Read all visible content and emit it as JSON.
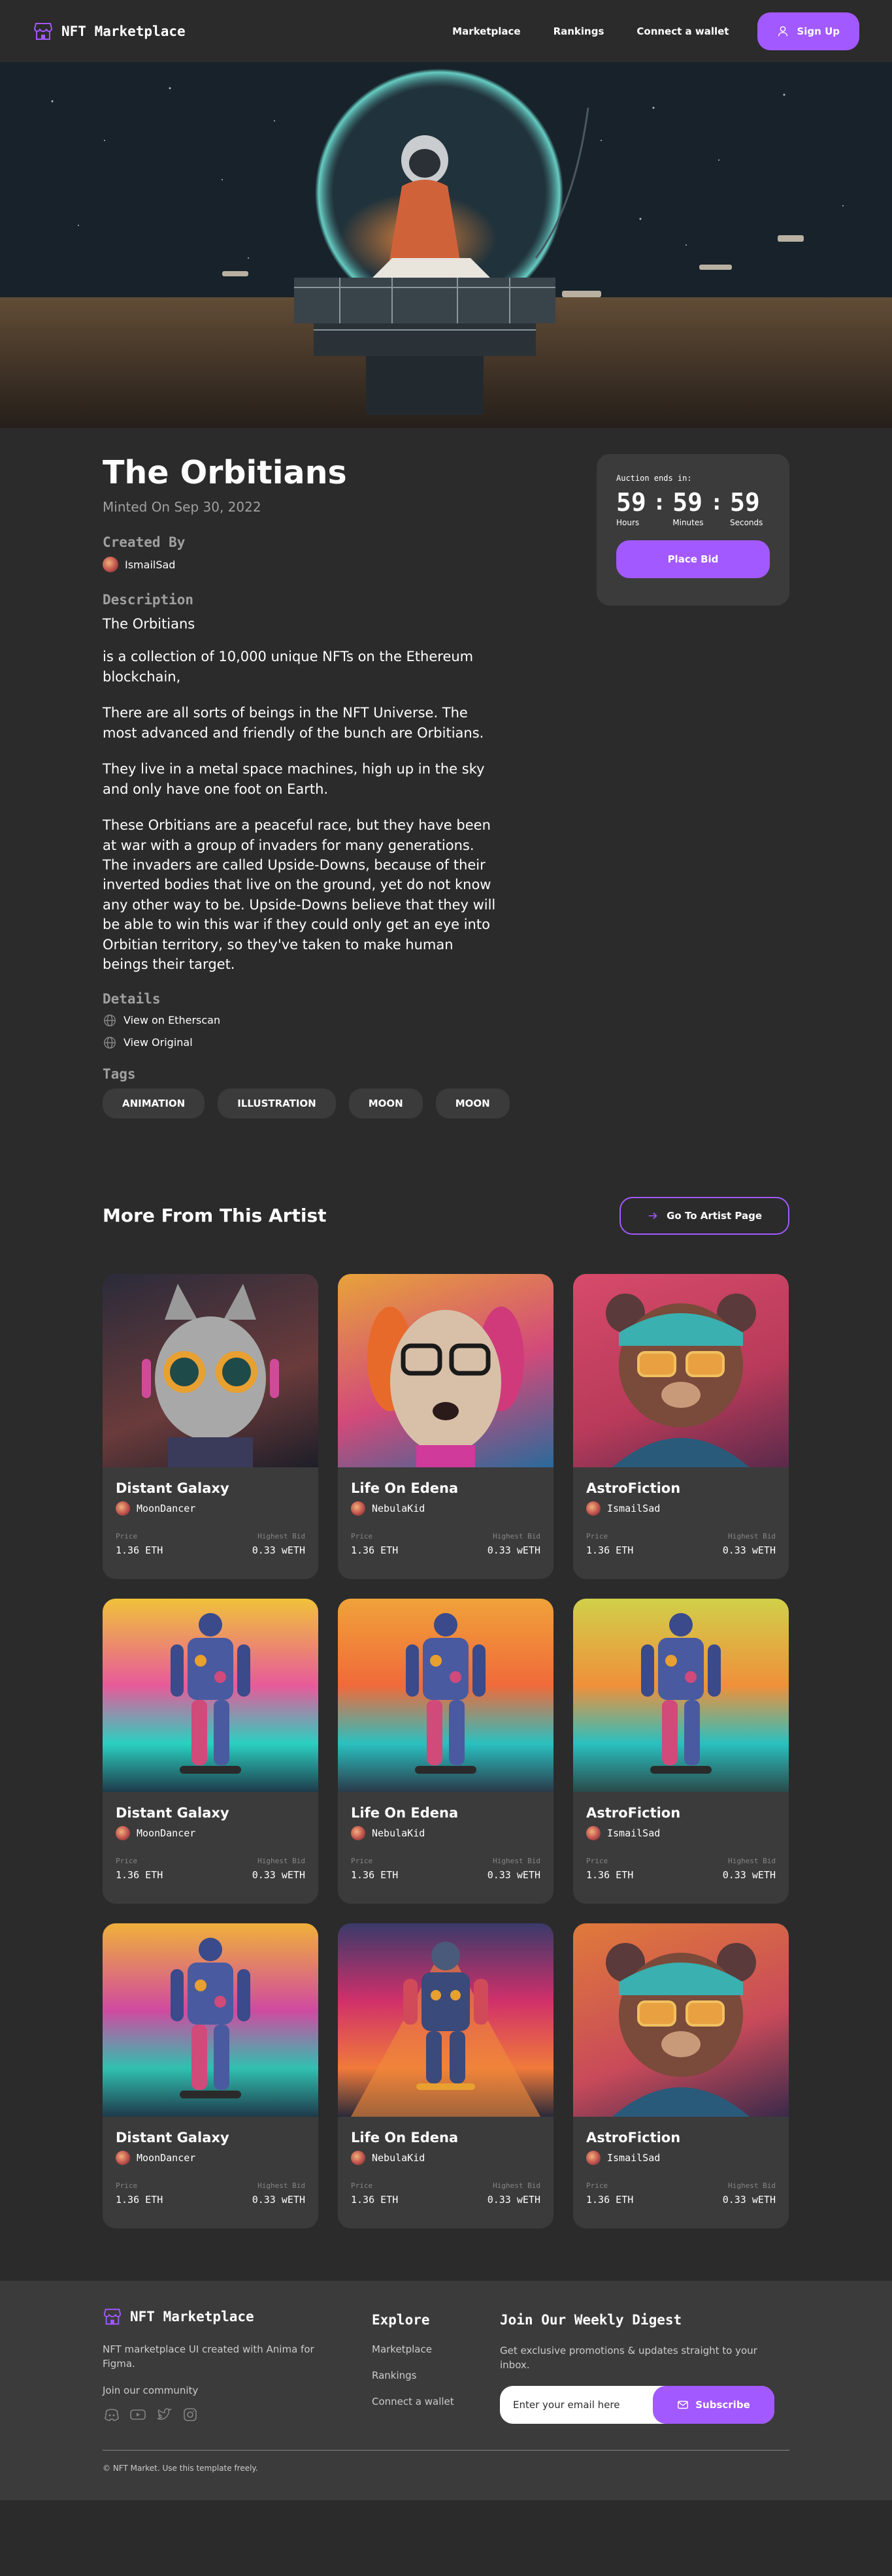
{
  "nav": {
    "brand": "NFT Marketplace",
    "links": [
      "Marketplace",
      "Rankings",
      "Connect a wallet"
    ],
    "signup": "Sign Up"
  },
  "nft": {
    "title": "The Orbitians",
    "minted": "Minted On Sep 30, 2022",
    "created_by_label": "Created By",
    "creator": "IsmailSad",
    "description_label": "Description",
    "description": [
      "The Orbitians",
      "is a collection of 10,000 unique NFTs on the Ethereum blockchain,",
      "There are all sorts of beings in the NFT Universe. The most advanced and friendly of the bunch are Orbitians.",
      "They live in a metal space machines, high up in the sky and only have one foot on Earth.",
      "These Orbitians are a peaceful race, but they have been at war with a group of invaders for many generations. The invaders are called Upside-Downs, because of their inverted bodies that live on the ground, yet do not know any other way to be. Upside-Downs believe that they will be able to win this war if they could only get an eye into Orbitian territory, so they've taken to make human beings their target."
    ],
    "details_label": "Details",
    "details": [
      "View on Etherscan",
      "View Original"
    ],
    "tags_label": "Tags",
    "tags": [
      "ANIMATION",
      "ILLUSTRATION",
      "MOON",
      "MOON"
    ]
  },
  "auction": {
    "label": "Auction ends in:",
    "hours": "59",
    "minutes": "59",
    "seconds": "59",
    "hours_label": "Hours",
    "minutes_label": "Minutes",
    "seconds_label": "Seconds",
    "bid": "Place Bid"
  },
  "more": {
    "title": "More From This Artist",
    "button": "Go To Artist Page",
    "price_label": "Price",
    "bid_label": "Highest Bid",
    "cards": [
      {
        "title": "Distant Galaxy",
        "artist": "MoonDancer",
        "price": "1.36 ETH",
        "bid": "0.33 wETH"
      },
      {
        "title": "Life On Edena",
        "artist": "NebulaKid",
        "price": "1.36 ETH",
        "bid": "0.33 wETH"
      },
      {
        "title": "AstroFiction",
        "artist": "IsmailSad",
        "price": "1.36 ETH",
        "bid": "0.33 wETH"
      },
      {
        "title": "Distant Galaxy",
        "artist": "MoonDancer",
        "price": "1.36 ETH",
        "bid": "0.33 wETH"
      },
      {
        "title": "Life On Edena",
        "artist": "NebulaKid",
        "price": "1.36 ETH",
        "bid": "0.33 wETH"
      },
      {
        "title": "AstroFiction",
        "artist": "IsmailSad",
        "price": "1.36 ETH",
        "bid": "0.33 wETH"
      },
      {
        "title": "Distant Galaxy",
        "artist": "MoonDancer",
        "price": "1.36 ETH",
        "bid": "0.33 wETH"
      },
      {
        "title": "Life On Edena",
        "artist": "NebulaKid",
        "price": "1.36 ETH",
        "bid": "0.33 wETH"
      },
      {
        "title": "AstroFiction",
        "artist": "IsmailSad",
        "price": "1.36 ETH",
        "bid": "0.33 wETH"
      }
    ]
  },
  "footer": {
    "brand": "NFT Marketplace",
    "tagline": "NFT marketplace UI created with Anima for Figma.",
    "community": "Join our community",
    "explore_title": "Explore",
    "explore_links": [
      "Marketplace",
      "Rankings",
      "Connect a wallet"
    ],
    "digest_title": "Join Our Weekly Digest",
    "digest_text": "Get exclusive promotions & updates straight to your inbox.",
    "email_placeholder": "Enter your email here",
    "subscribe": "Subscribe",
    "copyright": "© NFT Market. Use this template freely."
  },
  "colors": {
    "accent": "#a259ff",
    "background": "#2b2b2b",
    "surface": "#3b3b3b",
    "muted": "#858584"
  }
}
